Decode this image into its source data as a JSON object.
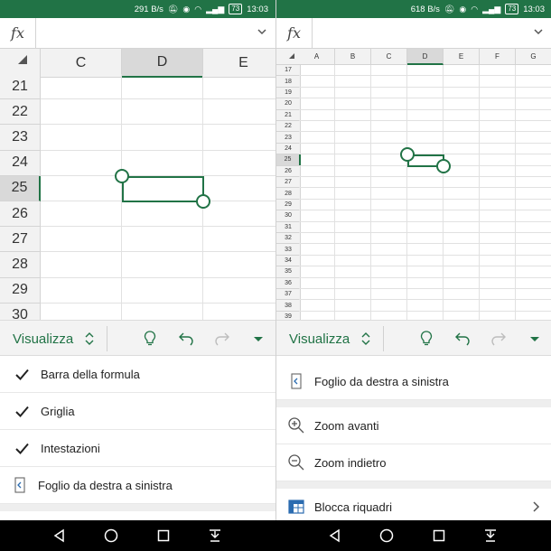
{
  "left": {
    "statusbar": {
      "speed": "291 B/s",
      "battery": "73",
      "time": "13:03"
    },
    "formula_bar": {
      "fx": "fx",
      "value": ""
    },
    "columns": [
      "C",
      "D",
      "E"
    ],
    "selected_column": "D",
    "rows": [
      "21",
      "22",
      "23",
      "24",
      "25",
      "26",
      "27",
      "28",
      "29",
      "30"
    ],
    "selected_row": "25",
    "ribbon": {
      "tab_label": "Visualizza"
    },
    "menu": [
      {
        "label": "Barra della formula",
        "checked": true
      },
      {
        "label": "Griglia",
        "checked": true
      },
      {
        "label": "Intestazioni",
        "checked": true
      },
      {
        "label": "Foglio da destra a sinistra"
      }
    ]
  },
  "right": {
    "statusbar": {
      "speed": "618 B/s",
      "battery": "73",
      "time": "13:03"
    },
    "formula_bar": {
      "fx": "fx",
      "value": ""
    },
    "columns": [
      "A",
      "B",
      "C",
      "D",
      "E",
      "F",
      "G"
    ],
    "selected_column": "D",
    "rows": [
      "17",
      "18",
      "19",
      "20",
      "21",
      "22",
      "23",
      "24",
      "25",
      "26",
      "27",
      "28",
      "29",
      "30",
      "31",
      "32",
      "33",
      "34",
      "35",
      "36",
      "37",
      "38",
      "39"
    ],
    "selected_row": "25",
    "ribbon": {
      "tab_label": "Visualizza"
    },
    "menu": [
      {
        "label": "Foglio da destra a sinistra"
      },
      {
        "label": "Zoom avanti"
      },
      {
        "label": "Zoom indietro"
      },
      {
        "label": "Blocca riquadri"
      }
    ]
  },
  "icons": {
    "ribbon": [
      "lightbulb-icon",
      "undo-icon",
      "redo-icon",
      "dropdown-arrow-icon"
    ],
    "nav": [
      "back-icon",
      "home-icon",
      "recents-icon",
      "notification-pull-icon"
    ]
  },
  "colors": {
    "accent": "#217346",
    "status_bar": "#217346",
    "ribbon_bg": "#f3f3f3"
  }
}
